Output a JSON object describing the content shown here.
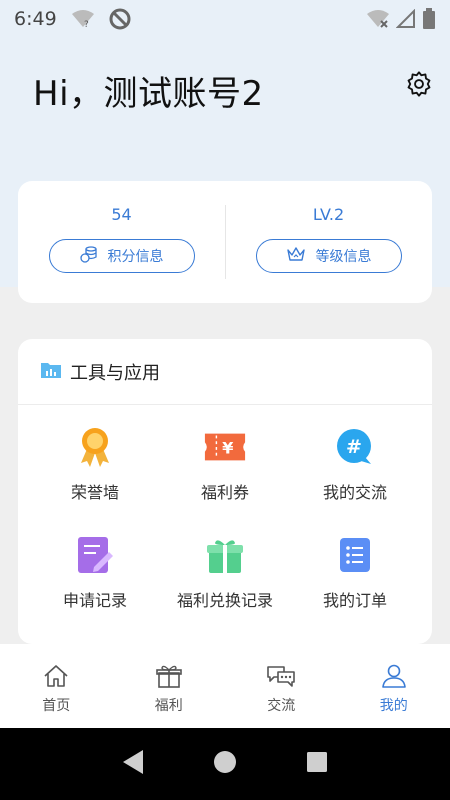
{
  "status_bar": {
    "time": "6:49"
  },
  "header": {
    "greeting": "Hi，测试账号2"
  },
  "stats": {
    "points_value": "54",
    "points_button": "积分信息",
    "level_value": "LV.2",
    "level_button": "等级信息"
  },
  "tools": {
    "title": "工具与应用",
    "items": [
      {
        "label": "荣誉墙",
        "icon": "medal-icon"
      },
      {
        "label": "福利券",
        "icon": "coupon-icon"
      },
      {
        "label": "我的交流",
        "icon": "hashtag-chat-icon"
      },
      {
        "label": "申请记录",
        "icon": "edit-document-icon"
      },
      {
        "label": "福利兑换记录",
        "icon": "gift-box-icon"
      },
      {
        "label": "我的订单",
        "icon": "order-list-icon"
      }
    ]
  },
  "bottom_nav": {
    "items": [
      {
        "label": "首页",
        "icon": "home-icon"
      },
      {
        "label": "福利",
        "icon": "gift-icon"
      },
      {
        "label": "交流",
        "icon": "chat-icon"
      },
      {
        "label": "我的",
        "icon": "user-icon",
        "active": true
      }
    ]
  },
  "colors": {
    "accent": "#3a7bd5",
    "header_bg": "#e8f0f8",
    "page_bg": "#efefef"
  }
}
